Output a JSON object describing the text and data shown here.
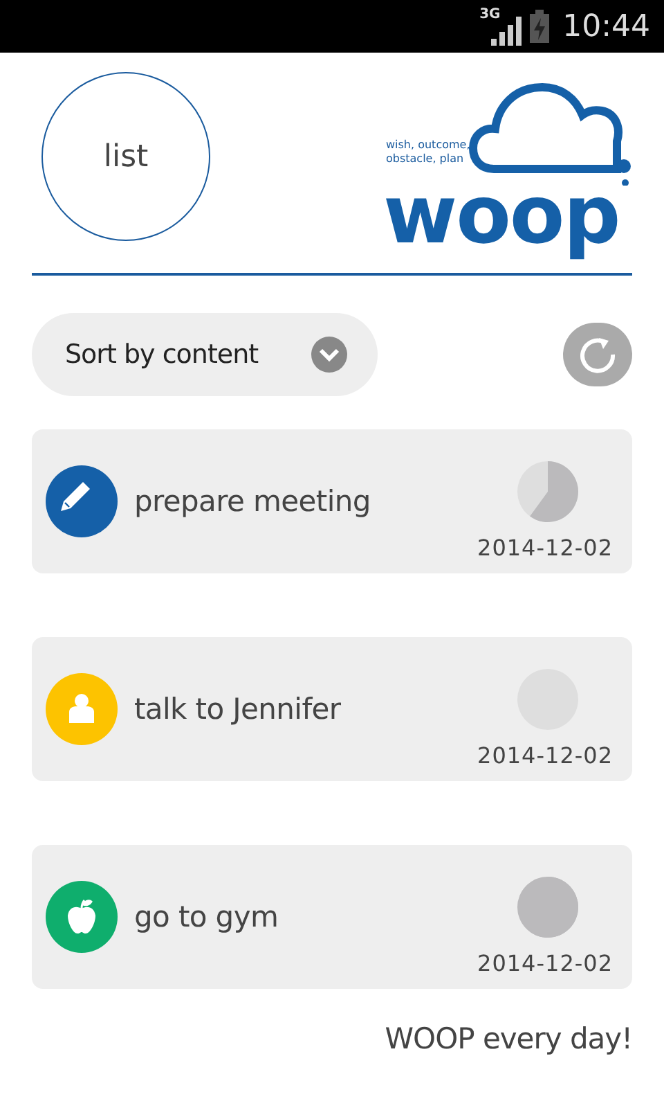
{
  "status_bar": {
    "network": "3G",
    "time": "10:44"
  },
  "header": {
    "list_button": "list",
    "logo": {
      "tagline": "wish, outcome, obstacle, plan",
      "wordmark": "woop"
    }
  },
  "sort": {
    "label": "Sort by content"
  },
  "cards": [
    {
      "kind": "pencil",
      "color": "#1560a8",
      "title": "prepare meeting",
      "started": true,
      "done": false,
      "date": "2014-12-02"
    },
    {
      "kind": "person",
      "color": "#fdc300",
      "title": "talk to Jennifer",
      "started": false,
      "done": false,
      "date": "2014-12-02"
    },
    {
      "kind": "apple",
      "color": "#0fae6d",
      "title": "go to gym",
      "started": true,
      "done": true,
      "date": "2014-12-02"
    }
  ],
  "footer": "WOOP every day!"
}
